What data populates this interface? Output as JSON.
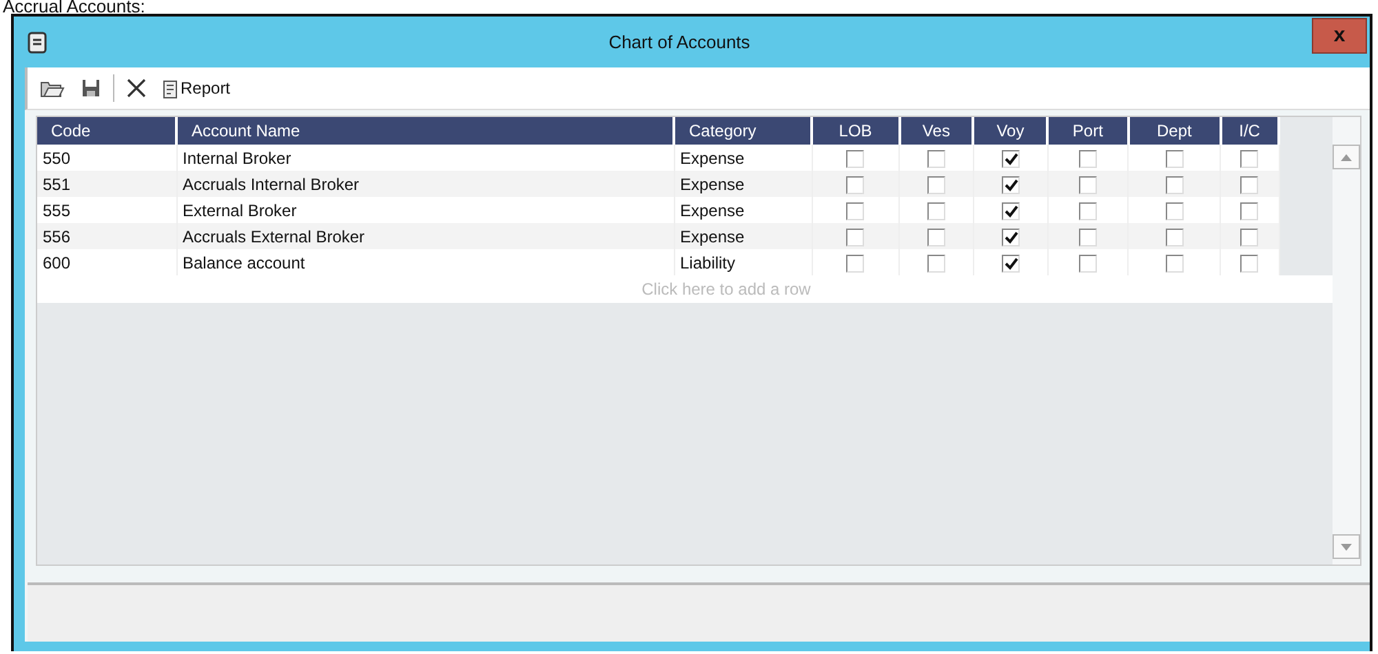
{
  "caption": "Accrual Accounts:",
  "window": {
    "title": "Chart of Accounts",
    "close": "x"
  },
  "toolbar": {
    "buttons": [
      {
        "kind": "open"
      },
      {
        "kind": "save"
      },
      {
        "kind": "delete"
      },
      {
        "kind": "report",
        "label": "Report"
      }
    ]
  },
  "table": {
    "columns": [
      {
        "label": "Code",
        "kind": "text"
      },
      {
        "label": "Account Name",
        "kind": "text"
      },
      {
        "label": "Category",
        "kind": "text"
      },
      {
        "label": "LOB",
        "kind": "check"
      },
      {
        "label": "Ves",
        "kind": "check"
      },
      {
        "label": "Voy",
        "kind": "check"
      },
      {
        "label": "Port",
        "kind": "check"
      },
      {
        "label": "Dept",
        "kind": "check"
      },
      {
        "label": "I/C",
        "kind": "check"
      }
    ],
    "rows": [
      {
        "cells": [
          "550",
          "Internal Broker",
          "Expense",
          {
            "checked": false
          },
          {
            "checked": false
          },
          {
            "checked": true
          },
          {
            "checked": false
          },
          {
            "checked": false
          },
          {
            "checked": false
          }
        ]
      },
      {
        "cells": [
          "551",
          "Accruals Internal Broker",
          "Expense",
          {
            "checked": false
          },
          {
            "checked": false
          },
          {
            "checked": true
          },
          {
            "checked": false
          },
          {
            "checked": false
          },
          {
            "checked": false
          }
        ]
      },
      {
        "cells": [
          "555",
          "External Broker",
          "Expense",
          {
            "checked": false
          },
          {
            "checked": false
          },
          {
            "checked": true
          },
          {
            "checked": false
          },
          {
            "checked": false
          },
          {
            "checked": false
          }
        ]
      },
      {
        "cells": [
          "556",
          "Accruals External Broker",
          "Expense",
          {
            "checked": false
          },
          {
            "checked": false
          },
          {
            "checked": true
          },
          {
            "checked": false
          },
          {
            "checked": false
          },
          {
            "checked": false
          }
        ]
      },
      {
        "cells": [
          "600",
          "Balance account",
          "Liability",
          {
            "checked": false
          },
          {
            "checked": false
          },
          {
            "checked": true
          },
          {
            "checked": false
          },
          {
            "checked": false
          },
          {
            "checked": false
          }
        ]
      }
    ],
    "add_row": "Click here to add a row"
  }
}
